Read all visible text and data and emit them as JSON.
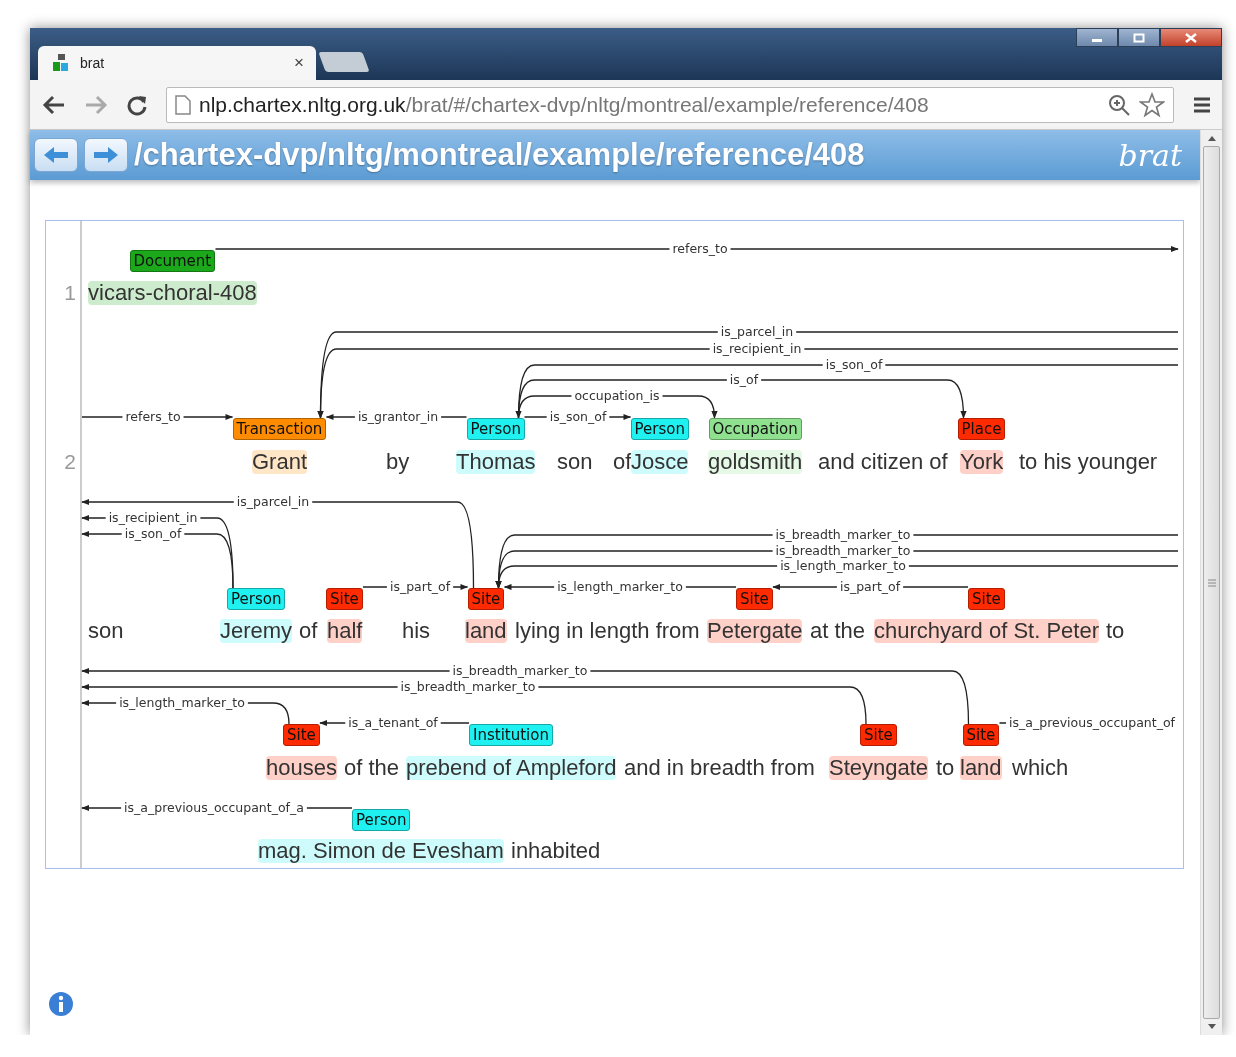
{
  "browser": {
    "tab_title": "brat",
    "tab_close": "×",
    "url_host": "nlp.chartex.nltg.org.uk",
    "url_path": "/brat/#/chartex-dvp/nltg/montreal/example/reference/408"
  },
  "header": {
    "path": "/chartex-dvp/nltg/montreal/example/reference/408",
    "logo": "brat"
  },
  "rows": [
    {
      "number": "1",
      "tokens": [
        {
          "text": "vicars-choral-408",
          "entity": {
            "type": "Document",
            "color": "#1ba81b"
          }
        }
      ],
      "arcs": [
        {
          "label": "refers_to"
        }
      ]
    },
    {
      "number": "2",
      "tokens": [
        {
          "text": "Grant",
          "entity": {
            "type": "Transaction",
            "color": "#ff8c00"
          }
        },
        {
          "text": "by"
        },
        {
          "text": "Thomas",
          "entity": {
            "type": "Person",
            "color": "#1ff0f0"
          }
        },
        {
          "text": "son"
        },
        {
          "text": "of"
        },
        {
          "text": "Josce",
          "entity": {
            "type": "Person",
            "color": "#1ff0f0"
          }
        },
        {
          "text": "goldsmith",
          "entity": {
            "type": "Occupation",
            "color": "#8fe08f"
          }
        },
        {
          "text": "and citizen of"
        },
        {
          "text": "York",
          "entity": {
            "type": "Place",
            "color": "#ff2a00"
          }
        },
        {
          "text": "to his younger"
        }
      ],
      "arcs": [
        {
          "label": "is_parcel_in"
        },
        {
          "label": "is_recipient_in"
        },
        {
          "label": "is_son_of"
        },
        {
          "label": "is_of"
        },
        {
          "label": "occupation_is"
        },
        {
          "label": "refers_to"
        },
        {
          "label": "is_grantor_in"
        },
        {
          "label": "is_son_of"
        }
      ]
    },
    {
      "tokens": [
        {
          "text": "son"
        },
        {
          "text": "Jeremy",
          "entity": {
            "type": "Person",
            "color": "#1ff0f0"
          }
        },
        {
          "text": "of"
        },
        {
          "text": "half",
          "entity": {
            "type": "Site",
            "color": "#ff2a00"
          }
        },
        {
          "text": "his"
        },
        {
          "text": "land",
          "entity": {
            "type": "Site",
            "color": "#ff2a00"
          }
        },
        {
          "text": "lying in length from"
        },
        {
          "text": "Petergate",
          "entity": {
            "type": "Site",
            "color": "#ff2a00"
          }
        },
        {
          "text": "at the"
        },
        {
          "text": "churchyard of St. Peter",
          "entity": {
            "type": "Site",
            "color": "#ff2a00"
          }
        },
        {
          "text": "to"
        }
      ],
      "arcs": [
        {
          "label": "is_parcel_in"
        },
        {
          "label": "is_recipient_in"
        },
        {
          "label": "is_son_of"
        },
        {
          "label": "is_breadth_marker_to"
        },
        {
          "label": "is_breadth_marker_to"
        },
        {
          "label": "is_length_marker_to"
        },
        {
          "label": "is_part_of"
        },
        {
          "label": "is_length_marker_to"
        },
        {
          "label": "is_part_of"
        }
      ]
    },
    {
      "tokens": [
        {
          "text": "houses",
          "entity": {
            "type": "Site",
            "color": "#ff2a00"
          }
        },
        {
          "text": "of the"
        },
        {
          "text": "prebend of Ampleford",
          "entity": {
            "type": "Institution",
            "color": "#1ff0f0"
          }
        },
        {
          "text": "and in breadth from"
        },
        {
          "text": "Steyngate",
          "entity": {
            "type": "Site",
            "color": "#ff2a00"
          }
        },
        {
          "text": "to"
        },
        {
          "text": "land",
          "entity": {
            "type": "Site",
            "color": "#ff2a00"
          }
        },
        {
          "text": "which"
        }
      ],
      "arcs": [
        {
          "label": "is_breadth_marker_to"
        },
        {
          "label": "is_breadth_marker_to"
        },
        {
          "label": "is_length_marker_to"
        },
        {
          "label": "is_a_tenant_of"
        },
        {
          "label": "is_a_previous_occupant_of"
        }
      ]
    },
    {
      "tokens": [
        {
          "text": "mag. Simon de Evesham",
          "entity": {
            "type": "Person",
            "color": "#1ff0f0"
          }
        },
        {
          "text": "inhabited"
        }
      ],
      "arcs": [
        {
          "label": "is_a_previous_occupant_of_a"
        }
      ]
    }
  ]
}
